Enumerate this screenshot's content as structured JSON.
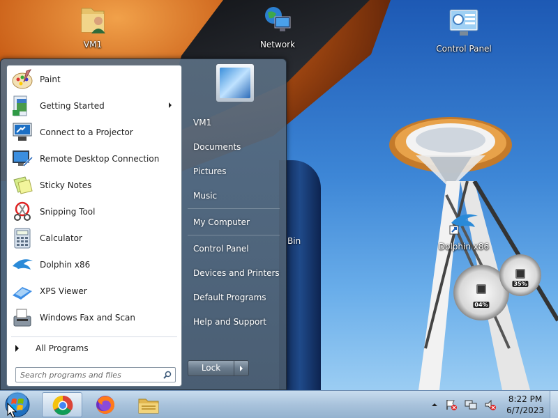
{
  "desktop": {
    "icons": [
      {
        "label": "VM1"
      },
      {
        "label": "Network"
      },
      {
        "label": "Control Panel"
      },
      {
        "label": "Dolphin x86"
      }
    ],
    "partial_label": "Bin",
    "gadgets": {
      "cpu_percent": "04%",
      "memory_percent": "35%"
    }
  },
  "start_menu": {
    "programs": [
      {
        "label": "Paint",
        "icon": "paint-icon"
      },
      {
        "label": "Getting Started",
        "icon": "getting-started-icon",
        "has_submenu": true
      },
      {
        "label": "Connect to a Projector",
        "icon": "projector-icon"
      },
      {
        "label": "Remote Desktop Connection",
        "icon": "remote-desktop-icon"
      },
      {
        "label": "Sticky Notes",
        "icon": "sticky-notes-icon"
      },
      {
        "label": "Snipping Tool",
        "icon": "snipping-tool-icon"
      },
      {
        "label": "Calculator",
        "icon": "calculator-icon"
      },
      {
        "label": "Dolphin x86",
        "icon": "dolphin-icon"
      },
      {
        "label": "XPS Viewer",
        "icon": "xps-viewer-icon"
      },
      {
        "label": "Windows Fax and Scan",
        "icon": "fax-scan-icon"
      }
    ],
    "all_programs": "All Programs",
    "search_placeholder": "Search programs and files",
    "right_links": [
      {
        "label": "VM1"
      },
      {
        "label": "Documents"
      },
      {
        "label": "Pictures"
      },
      {
        "label": "Music"
      },
      {
        "label": "My Computer"
      },
      {
        "label": "Control Panel"
      },
      {
        "label": "Devices and Printers"
      },
      {
        "label": "Default Programs"
      },
      {
        "label": "Help and Support"
      }
    ],
    "lock_label": "Lock"
  },
  "taskbar": {
    "apps": [
      {
        "name": "chrome-icon",
        "active": true
      },
      {
        "name": "firefox-icon",
        "active": false
      },
      {
        "name": "file-explorer-icon",
        "active": false
      }
    ],
    "clock": {
      "time": "8:22 PM",
      "date": "6/7/2023"
    }
  },
  "colors": {
    "menu_frame": "#5a6e82",
    "taskbar": "#a9c3dc",
    "sky": "#3d86d6"
  }
}
